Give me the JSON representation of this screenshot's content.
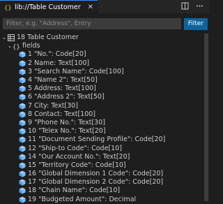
{
  "tab": {
    "title": "lib://Table Customer",
    "close": "✕"
  },
  "filter": {
    "placeholder": "Filter, e.g. \"Address\", Entry",
    "button": "Filter"
  },
  "tree": {
    "root": "18 Table Customer",
    "group": "fields",
    "fields": [
      "1 \"No.\": Code[20]",
      "2 Name: Text[100]",
      "3 \"Search Name\": Code[100]",
      "4 \"Name 2\": Text[50]",
      "5 Address: Text[100]",
      "6 \"Address 2\": Text[50]",
      "7 City: Text[30]",
      "8 Contact: Text[100]",
      "9 \"Phone No.\": Text[30]",
      "10 \"Telex No.\": Text[20]",
      "11 \"Document Sending Profile\": Code[20]",
      "12 \"Ship-to Code\": Code[10]",
      "14 \"Our Account No.\": Text[20]",
      "15 \"Territory Code\": Code[10]",
      "16 \"Global Dimension 1 Code\": Code[20]",
      "17 \"Global Dimension 2 Code\": Code[20]",
      "18 \"Chain Name\": Code[10]",
      "19 \"Budgeted Amount\": Decimal"
    ]
  },
  "colors": {
    "accent": "#0e639c",
    "field_icon": "#75beff"
  }
}
